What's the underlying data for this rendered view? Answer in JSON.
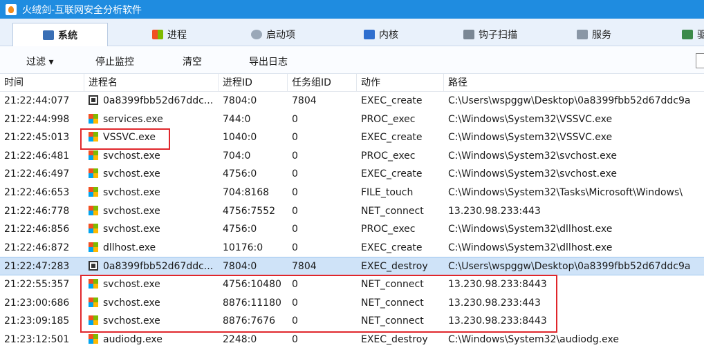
{
  "window": {
    "title": "火绒剑-互联网安全分析软件"
  },
  "tabs": [
    {
      "label": "系统",
      "icon": "system-monitor-icon",
      "active": true
    },
    {
      "label": "进程",
      "icon": "process-windows-icon",
      "active": false
    },
    {
      "label": "启动项",
      "icon": "startup-gear-icon",
      "active": false
    },
    {
      "label": "内核",
      "icon": "kernel-user-icon",
      "active": false
    },
    {
      "label": "钩子扫描",
      "icon": "hook-scan-icon",
      "active": false
    },
    {
      "label": "服务",
      "icon": "service-icon",
      "active": false
    },
    {
      "label": "驱",
      "icon": "driver-icon",
      "active": false
    }
  ],
  "toolbar": {
    "filter_label": "过滤 ▾",
    "stop_label": "停止监控",
    "clear_label": "清空",
    "export_label": "导出日志"
  },
  "columns": [
    "时间",
    "进程名",
    "进程ID",
    "任务组ID",
    "动作",
    "路径"
  ],
  "rows": [
    {
      "time": "21:22:44:077",
      "icon": "binary-file-icon",
      "name": "0a8399fbb52d67ddc...",
      "pid": "7804:0",
      "tid": "7804",
      "action": "EXEC_create",
      "path": "C:\\Users\\wspggw\\Desktop\\0a8399fbb52d67ddc9a"
    },
    {
      "time": "21:22:44:998",
      "icon": "windows-process-icon",
      "name": "services.exe",
      "pid": "744:0",
      "tid": "0",
      "action": "PROC_exec",
      "path": "C:\\Windows\\System32\\VSSVC.exe"
    },
    {
      "time": "21:22:45:013",
      "icon": "windows-process-icon",
      "name": "VSSVC.exe",
      "pid": "1040:0",
      "tid": "0",
      "action": "EXEC_create",
      "path": "C:\\Windows\\System32\\VSSVC.exe"
    },
    {
      "time": "21:22:46:481",
      "icon": "windows-process-icon",
      "name": "svchost.exe",
      "pid": "704:0",
      "tid": "0",
      "action": "PROC_exec",
      "path": "C:\\Windows\\System32\\svchost.exe"
    },
    {
      "time": "21:22:46:497",
      "icon": "windows-process-icon",
      "name": "svchost.exe",
      "pid": "4756:0",
      "tid": "0",
      "action": "EXEC_create",
      "path": "C:\\Windows\\System32\\svchost.exe"
    },
    {
      "time": "21:22:46:653",
      "icon": "windows-process-icon",
      "name": "svchost.exe",
      "pid": "704:8168",
      "tid": "0",
      "action": "FILE_touch",
      "path": "C:\\Windows\\System32\\Tasks\\Microsoft\\Windows\\"
    },
    {
      "time": "21:22:46:778",
      "icon": "windows-process-icon",
      "name": "svchost.exe",
      "pid": "4756:7552",
      "tid": "0",
      "action": "NET_connect",
      "path": "13.230.98.233:443"
    },
    {
      "time": "21:22:46:856",
      "icon": "windows-process-icon",
      "name": "svchost.exe",
      "pid": "4756:0",
      "tid": "0",
      "action": "PROC_exec",
      "path": "C:\\Windows\\System32\\dllhost.exe"
    },
    {
      "time": "21:22:46:872",
      "icon": "windows-process-icon",
      "name": "dllhost.exe",
      "pid": "10176:0",
      "tid": "0",
      "action": "EXEC_create",
      "path": "C:\\Windows\\System32\\dllhost.exe"
    },
    {
      "time": "21:22:47:283",
      "icon": "binary-file-icon",
      "name": "0a8399fbb52d67ddc...",
      "pid": "7804:0",
      "tid": "7804",
      "action": "EXEC_destroy",
      "path": "C:\\Users\\wspggw\\Desktop\\0a8399fbb52d67ddc9a",
      "selected": true
    },
    {
      "time": "21:22:55:357",
      "icon": "windows-process-icon",
      "name": "svchost.exe",
      "pid": "4756:10480",
      "tid": "0",
      "action": "NET_connect",
      "path": "13.230.98.233:8443"
    },
    {
      "time": "21:23:00:686",
      "icon": "windows-process-icon",
      "name": "svchost.exe",
      "pid": "8876:11180",
      "tid": "0",
      "action": "NET_connect",
      "path": "13.230.98.233:443"
    },
    {
      "time": "21:23:09:185",
      "icon": "windows-process-icon",
      "name": "svchost.exe",
      "pid": "8876:7676",
      "tid": "0",
      "action": "NET_connect",
      "path": "13.230.98.233:8443"
    },
    {
      "time": "21:23:12:501",
      "icon": "windows-process-icon",
      "name": "audiodg.exe",
      "pid": "2248:0",
      "tid": "0",
      "action": "EXEC_destroy",
      "path": "C:\\Windows\\System32\\audiodg.exe"
    }
  ],
  "colors": {
    "title_bar": "#1f8ce0",
    "selected_row": "#cfe3f8",
    "highlight_box": "#e0262b"
  }
}
